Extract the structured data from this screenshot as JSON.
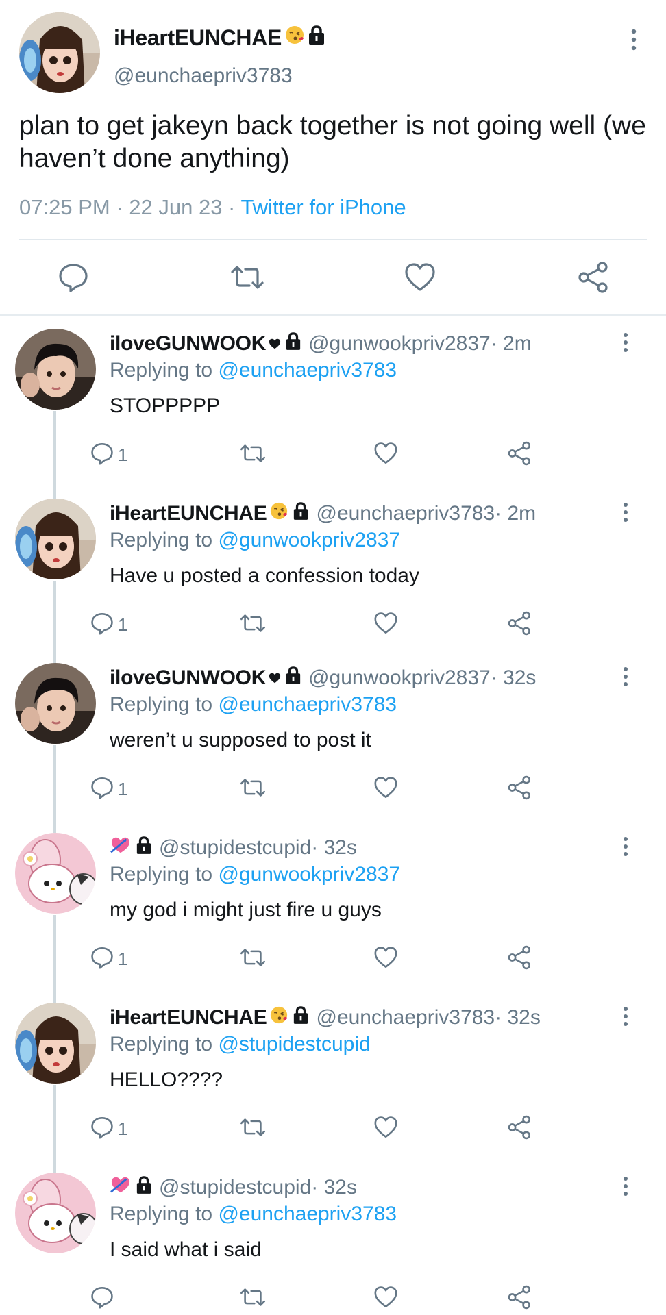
{
  "main_tweet": {
    "author_name": "iHeartEUNCHAE",
    "author_handle": "@eunchaepriv3783",
    "text": "plan to get jakeyn back together is not going well (we haven’t done anything)",
    "time": "07:25 PM",
    "date": "22 Jun 23",
    "source": "Twitter for iPhone",
    "meta_sep": " · "
  },
  "replies": [
    {
      "name": "iloveGUNWOOK",
      "handle": "@gunwookpriv2837",
      "time": " · 2m",
      "replying_label": "Replying to ",
      "replying_to": "@eunchaepriv3783",
      "text": "STOPPPPP",
      "reply_count": "1",
      "avatar": "boy"
    },
    {
      "name": "iHeartEUNCHAE",
      "handle": "@eunchaepriv3783",
      "time": " · 2m",
      "replying_label": "Replying to ",
      "replying_to": "@gunwookpriv2837",
      "text": "Have u posted a confession today",
      "reply_count": "1",
      "avatar": "girl"
    },
    {
      "name": "iloveGUNWOOK",
      "handle": "@gunwookpriv2837",
      "time": " · 32s",
      "replying_label": "Replying to ",
      "replying_to": "@eunchaepriv3783",
      "text": "weren’t u supposed to post it",
      "reply_count": "1",
      "avatar": "boy"
    },
    {
      "name": "",
      "handle": "@stupidestcupid",
      "time": " · 32s",
      "replying_label": "Replying to ",
      "replying_to": "@gunwookpriv2837",
      "text": "my god i might just fire u guys",
      "reply_count": "1",
      "avatar": "melody"
    },
    {
      "name": "iHeartEUNCHAE",
      "handle": "@eunchaepriv3783",
      "time": " · 32s",
      "replying_label": "Replying to ",
      "replying_to": "@stupidestcupid",
      "text": "HELLO????",
      "reply_count": "1",
      "avatar": "girl"
    },
    {
      "name": "",
      "handle": "@stupidestcupid",
      "time": " · 32s",
      "replying_label": "Replying to ",
      "replying_to": "@eunchaepriv3783",
      "text": "I said what i said",
      "reply_count": "",
      "avatar": "melody"
    }
  ],
  "colors": {
    "link": "#1da1f2",
    "secondary_text": "#657786",
    "divider": "#e1e8ed"
  },
  "icons": {
    "reply": "reply-icon",
    "retweet": "retweet-icon",
    "like": "like-icon",
    "share": "share-icon",
    "more": "more-icon",
    "lock": "lock-icon"
  }
}
